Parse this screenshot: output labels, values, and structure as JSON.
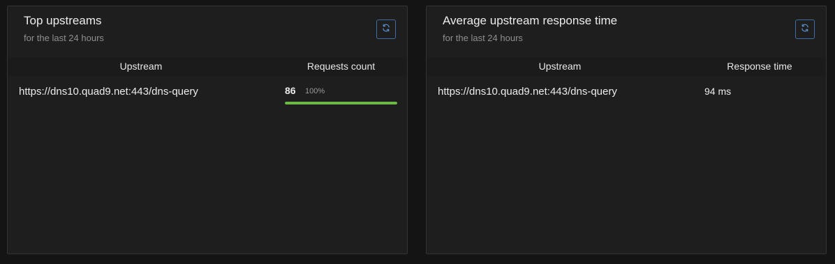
{
  "top_upstreams": {
    "title": "Top upstreams",
    "subtitle": "for the last 24 hours",
    "refresh_icon": "refresh-icon",
    "columns": [
      "Upstream",
      "Requests count"
    ],
    "rows": [
      {
        "upstream": "https://dns10.quad9.net:443/dns-query",
        "count": "86",
        "percent_label": "100%",
        "percent": 100
      }
    ]
  },
  "avg_response": {
    "title": "Average upstream response time",
    "subtitle": "for the last 24 hours",
    "refresh_icon": "refresh-icon",
    "columns": [
      "Upstream",
      "Response time"
    ],
    "rows": [
      {
        "upstream": "https://dns10.quad9.net:443/dns-query",
        "time": "94 ms"
      }
    ]
  },
  "colors": {
    "background": "#141414",
    "card": "#1e1e1e",
    "accent_button": "#3d6ea8",
    "progress": "#6cb944"
  }
}
